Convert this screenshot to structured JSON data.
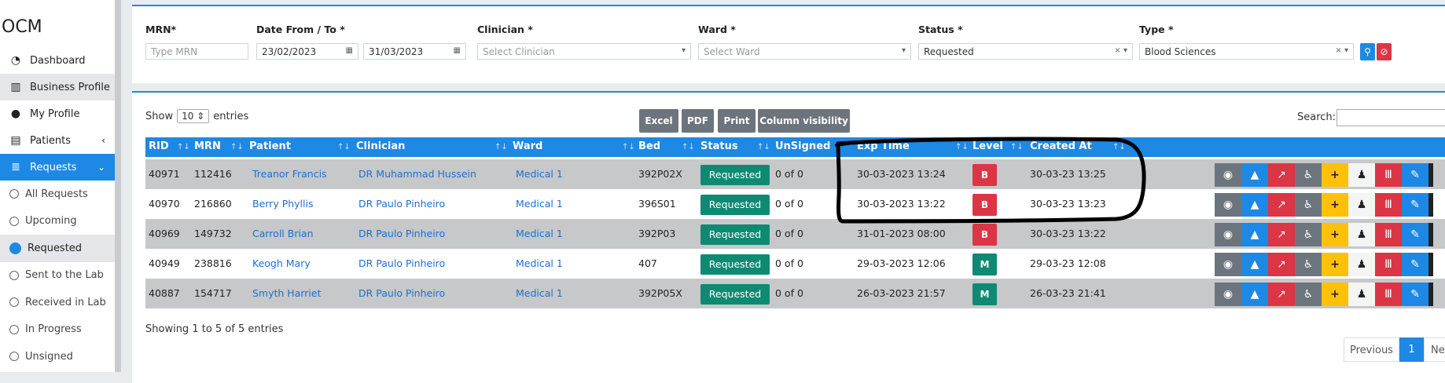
{
  "brand": "OCM",
  "sidebar": {
    "items": [
      {
        "label": "Dashboard",
        "icon": "dashboard-icon"
      },
      {
        "label": "Business Profile",
        "icon": "building-icon"
      },
      {
        "label": "My Profile",
        "icon": "user-icon"
      },
      {
        "label": "Patients",
        "icon": "patients-icon"
      },
      {
        "label": "Requests",
        "icon": "database-icon"
      }
    ],
    "subitems": [
      "All Requests",
      "Upcoming",
      "Requested",
      "Sent to the Lab",
      "Received in Lab",
      "In Progress",
      "Unsigned"
    ]
  },
  "filters": {
    "mrn_label": "MRN*",
    "mrn_placeholder": "Type MRN",
    "date_label": "Date From / To *",
    "date_from": "23/02/2023",
    "date_to": "31/03/2023",
    "clinician_label": "Clinician *",
    "clinician_placeholder": "Select Clinician",
    "ward_label": "Ward *",
    "ward_placeholder": "Select Ward",
    "status_label": "Status *",
    "status_value": "Requested",
    "type_label": "Type *",
    "type_value": "Blood Sciences"
  },
  "table_controls": {
    "show": "Show",
    "entries_value": "10",
    "entries": "entries",
    "buttons": [
      "Excel",
      "PDF",
      "Print",
      "Column visibility"
    ],
    "search_label": "Search:"
  },
  "columns": [
    "RID",
    "MRN",
    "Patient",
    "Clinician",
    "Ward",
    "Bed",
    "Status",
    "UnSigned",
    "Exp Time",
    "Level",
    "Created At"
  ],
  "rows": [
    {
      "rid": "40971",
      "mrn": "112416",
      "patient": "Treanor Francis",
      "clinician": "DR Muhammad Hussein",
      "ward": "Medical 1",
      "bed": "392P02X",
      "status": "Requested",
      "unsigned": "0 of 0",
      "exp": "30-03-2023 13:24",
      "level": "B",
      "created": "30-03-23 13:25"
    },
    {
      "rid": "40970",
      "mrn": "216860",
      "patient": "Berry Phyllis",
      "clinician": "DR Paulo Pinheiro",
      "ward": "Medical 1",
      "bed": "396S01",
      "status": "Requested",
      "unsigned": "0 of 0",
      "exp": "30-03-2023 13:22",
      "level": "B",
      "created": "30-03-23 13:23"
    },
    {
      "rid": "40969",
      "mrn": "149732",
      "patient": "Carroll Brian",
      "clinician": "DR Paulo Pinheiro",
      "ward": "Medical 1",
      "bed": "392P03",
      "status": "Requested",
      "unsigned": "0 of 0",
      "exp": "31-01-2023 08:00",
      "level": "B",
      "created": "30-03-23 13:22"
    },
    {
      "rid": "40949",
      "mrn": "238816",
      "patient": "Keogh Mary",
      "clinician": "DR Paulo Pinheiro",
      "ward": "Medical 1",
      "bed": "407",
      "status": "Requested",
      "unsigned": "0 of 0",
      "exp": "29-03-2023 12:06",
      "level": "M",
      "created": "29-03-23 12:08"
    },
    {
      "rid": "40887",
      "mrn": "154717",
      "patient": "Smyth Harriet",
      "clinician": "DR Paulo Pinheiro",
      "ward": "Medical 1",
      "bed": "392P05X",
      "status": "Requested",
      "unsigned": "0 of 0",
      "exp": "26-03-2023 21:57",
      "level": "M",
      "created": "26-03-23 21:41"
    }
  ],
  "footer": {
    "info": "Showing 1 to 5 of 5 entries",
    "prev": "Previous",
    "page": "1",
    "next": "Ne"
  },
  "colors": {
    "primary": "#1e88e5",
    "success": "#0e8a73",
    "danger": "#dc3545",
    "warning": "#ffc107",
    "secondary": "#6c757d"
  }
}
